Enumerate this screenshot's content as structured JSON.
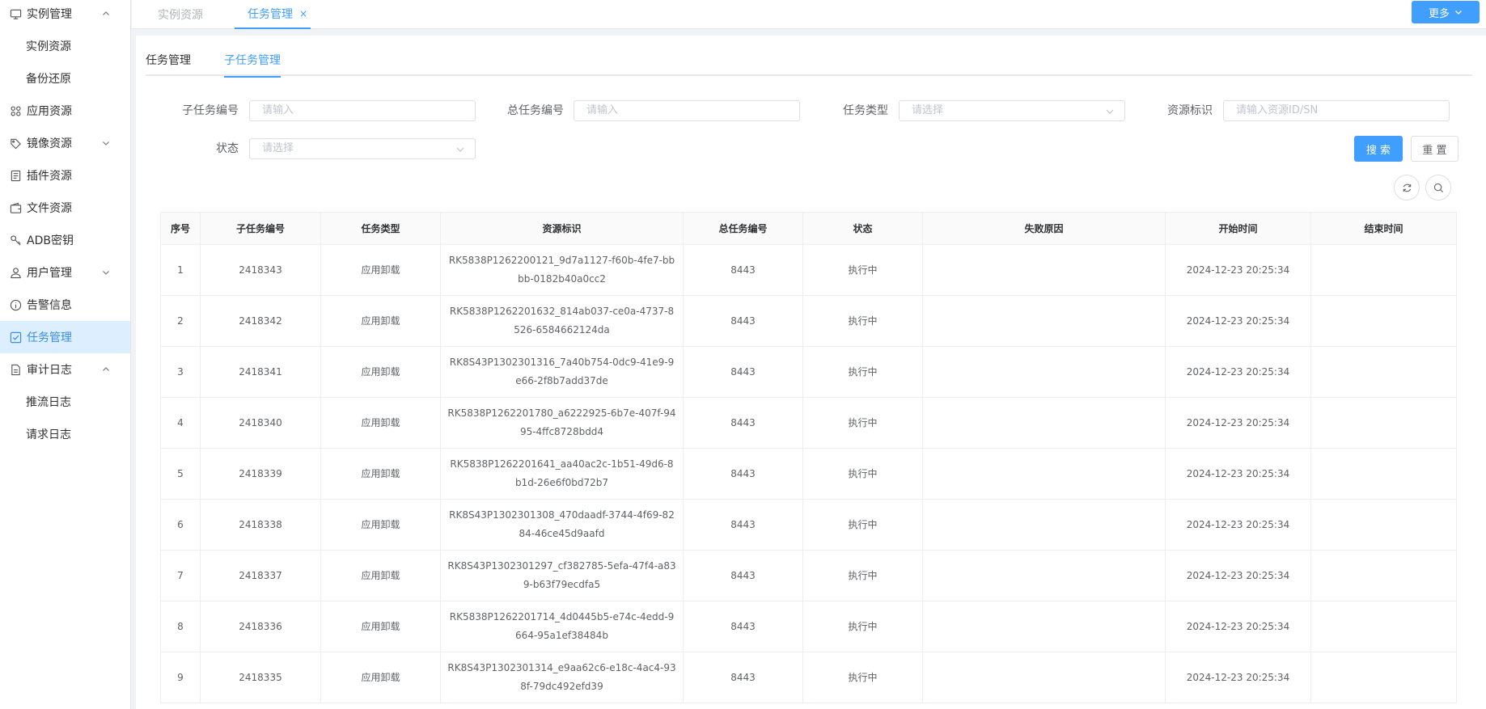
{
  "sidebar": {
    "items": [
      {
        "label": "实例管理",
        "icon": "monitor-icon",
        "expanded": true
      },
      {
        "label": "实例资源"
      },
      {
        "label": "备份还原"
      },
      {
        "label": "应用资源",
        "icon": "apps-grid-icon"
      },
      {
        "label": "镜像资源",
        "icon": "tag-icon",
        "expanded": false
      },
      {
        "label": "插件资源",
        "icon": "document-list-icon"
      },
      {
        "label": "文件资源",
        "icon": "wallet-icon"
      },
      {
        "label": "ADB密钥",
        "icon": "key-icon"
      },
      {
        "label": "用户管理",
        "icon": "user-icon",
        "expanded": false
      },
      {
        "label": "告警信息",
        "icon": "info-icon"
      },
      {
        "label": "任务管理",
        "icon": "checkbox-icon",
        "active": true
      },
      {
        "label": "审计日志",
        "icon": "file-icon",
        "expanded": true
      },
      {
        "label": "推流日志"
      },
      {
        "label": "请求日志"
      }
    ]
  },
  "topbar": {
    "tabs": [
      {
        "label": "实例资源"
      },
      {
        "label": "任务管理",
        "close": "×"
      }
    ],
    "more_label": "更多"
  },
  "subtabs": [
    "任务管理",
    "子任务管理"
  ],
  "filters": {
    "subtask_id": {
      "label": "子任务编号",
      "placeholder": "请输入"
    },
    "task_id": {
      "label": "总任务编号",
      "placeholder": "请输入"
    },
    "task_type": {
      "label": "任务类型",
      "placeholder": "请选择"
    },
    "resource": {
      "label": "资源标识",
      "placeholder": "请输入资源ID/SN"
    },
    "status": {
      "label": "状态",
      "placeholder": "请选择"
    },
    "search_label": "搜 索",
    "reset_label": "重 置"
  },
  "table": {
    "headers": [
      "序号",
      "子任务编号",
      "任务类型",
      "资源标识",
      "总任务编号",
      "状态",
      "失败原因",
      "开始时间",
      "结束时间"
    ],
    "rows": [
      [
        "1",
        "2418343",
        "应用卸载",
        "RK5838P1262200121_9d7a1127-f60b-4fe7-bbbb-0182b40a0cc2",
        "8443",
        "执行中",
        "",
        "2024-12-23 20:25:34",
        ""
      ],
      [
        "2",
        "2418342",
        "应用卸载",
        "RK5838P1262201632_814ab037-ce0a-4737-8526-6584662124da",
        "8443",
        "执行中",
        "",
        "2024-12-23 20:25:34",
        ""
      ],
      [
        "3",
        "2418341",
        "应用卸载",
        "RK8S43P1302301316_7a40b754-0dc9-41e9-9e66-2f8b7add37de",
        "8443",
        "执行中",
        "",
        "2024-12-23 20:25:34",
        ""
      ],
      [
        "4",
        "2418340",
        "应用卸载",
        "RK5838P1262201780_a6222925-6b7e-407f-9495-4ffc8728bdd4",
        "8443",
        "执行中",
        "",
        "2024-12-23 20:25:34",
        ""
      ],
      [
        "5",
        "2418339",
        "应用卸载",
        "RK5838P1262201641_aa40ac2c-1b51-49d6-8b1d-26e6f0bd72b7",
        "8443",
        "执行中",
        "",
        "2024-12-23 20:25:34",
        ""
      ],
      [
        "6",
        "2418338",
        "应用卸载",
        "RK8S43P1302301308_470daadf-3744-4f69-8284-46ce45d9aafd",
        "8443",
        "执行中",
        "",
        "2024-12-23 20:25:34",
        ""
      ],
      [
        "7",
        "2418337",
        "应用卸载",
        "RK8S43P1302301297_cf382785-5efa-47f4-a839-b63f79ecdfa5",
        "8443",
        "执行中",
        "",
        "2024-12-23 20:25:34",
        ""
      ],
      [
        "8",
        "2418336",
        "应用卸载",
        "RK5838P1262201714_4d0445b5-e74c-4edd-9664-95a1ef38484b",
        "8443",
        "执行中",
        "",
        "2024-12-23 20:25:34",
        ""
      ],
      [
        "9",
        "2418335",
        "应用卸载",
        "RK8S43P1302301314_e9aa62c6-e18c-4ac4-938f-79dc492efd39",
        "8443",
        "执行中",
        "",
        "2024-12-23 20:25:34",
        ""
      ]
    ]
  },
  "colors": {
    "accent": "#409eff",
    "active_bg": "#ddeeff"
  }
}
